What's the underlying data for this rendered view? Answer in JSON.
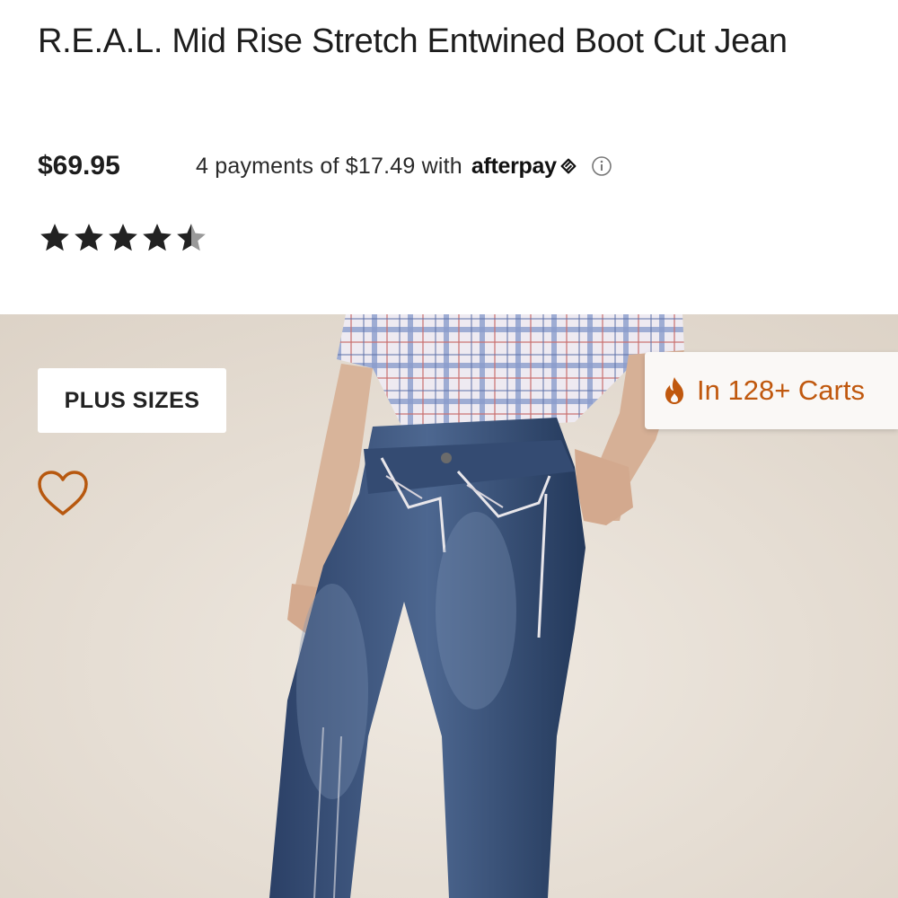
{
  "product": {
    "title": "R.E.A.L. Mid Rise Stretch Entwined Boot Cut Jean",
    "price": "$69.95",
    "installment_text": "4 payments of $17.49 with",
    "afterpay_brand": "afterpay",
    "rating": 4.5,
    "rating_max": 5
  },
  "badges": {
    "plus_sizes": "PLUS SIZES",
    "in_carts": "In 128+ Carts"
  },
  "icons": [
    "info-icon",
    "star-icon",
    "heart-icon",
    "flame-icon",
    "afterpay-arrows-icon"
  ],
  "colors": {
    "accent_orange": "#c0580e",
    "hero_background": "#e6ded4",
    "text_dark": "#1d1d1d"
  }
}
